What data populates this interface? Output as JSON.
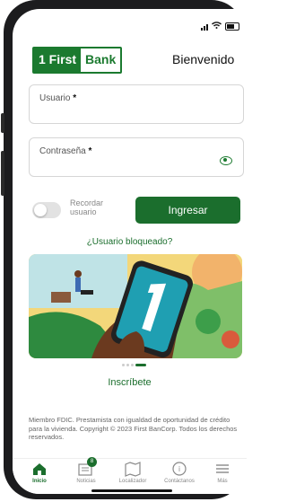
{
  "header": {
    "logo_left": "1 First",
    "logo_right": "Bank",
    "welcome": "Bienvenido"
  },
  "form": {
    "username_label": "Usuario",
    "password_label": "Contraseña",
    "required_mark": "*",
    "remember_label": "Recordar usuario",
    "login_button": "Ingresar",
    "blocked_link": "¿Usuario bloqueado?"
  },
  "banner": {
    "carousel_count": 4,
    "carousel_active": 4
  },
  "register_link": "Inscríbete",
  "legal": "Miembro FDIC. Prestamista con igualdad de oportunidad de crédito para la vivienda. Copyright © 2023 First BanCorp. Todos los derechos reservados.",
  "tabs": [
    {
      "label": "Inicio",
      "icon": "home-icon",
      "active": true
    },
    {
      "label": "Noticias",
      "icon": "news-icon",
      "badge": "8"
    },
    {
      "label": "Localizador",
      "icon": "map-icon"
    },
    {
      "label": "Contáctanos",
      "icon": "contact-icon"
    },
    {
      "label": "Más",
      "icon": "menu-icon"
    }
  ],
  "colors": {
    "brand_green": "#1b6e2d",
    "banner_yellow": "#f3d77a"
  }
}
